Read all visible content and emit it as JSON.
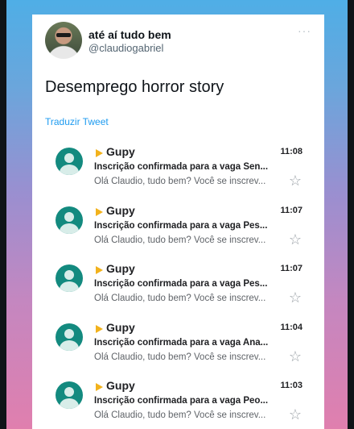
{
  "tweet": {
    "display_name": "até aí tudo bem",
    "handle": "@claudiogabriel",
    "more_icon": "···",
    "text": "Desemprego horror story",
    "translate_label": "Traduzir Tweet"
  },
  "emails": [
    {
      "sender": "Gupy",
      "time": "11:08",
      "subject": "Inscrição confirmada para a vaga Sen...",
      "snippet": "Olá Claudio, tudo bem? Você se inscrev...",
      "star": "☆"
    },
    {
      "sender": "Gupy",
      "time": "11:07",
      "subject": "Inscrição confirmada para a vaga Pes...",
      "snippet": "Olá Claudio, tudo bem? Você se inscrev...",
      "star": "☆"
    },
    {
      "sender": "Gupy",
      "time": "11:07",
      "subject": "Inscrição confirmada para a vaga Pes...",
      "snippet": "Olá Claudio, tudo bem? Você se inscrev...",
      "star": "☆"
    },
    {
      "sender": "Gupy",
      "time": "11:04",
      "subject": "Inscrição confirmada para a vaga Ana...",
      "snippet": "Olá Claudio, tudo bem? Você se inscrev...",
      "star": "☆"
    },
    {
      "sender": "Gupy",
      "time": "11:03",
      "subject": "Inscrição confirmada para a vaga Peo...",
      "snippet": "Olá Claudio, tudo bem? Você se inscrev...",
      "star": "☆"
    }
  ],
  "colors": {
    "link": "#1d9bf0",
    "avatar_teal": "#138a7f",
    "gupy_icon": "#f2b21c"
  }
}
